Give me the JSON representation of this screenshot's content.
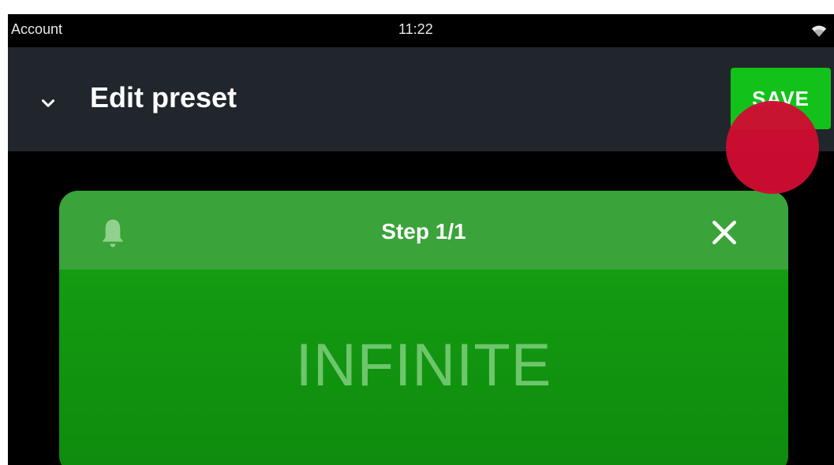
{
  "status_bar": {
    "account": "Account",
    "time": "11:22",
    "wifi_icon": "wifi-icon"
  },
  "app_bar": {
    "collapse_icon": "chevron-down-icon",
    "title": "Edit preset",
    "save_label": "SAVE",
    "save_color": "#12c21a"
  },
  "touch_indicator": {
    "color": "#cf0d32"
  },
  "step_card": {
    "bell_icon": "bell-icon",
    "step_label": "Step 1/1",
    "close_icon": "close-icon",
    "duration": "INFINITE",
    "accent_color": "#149c12"
  }
}
